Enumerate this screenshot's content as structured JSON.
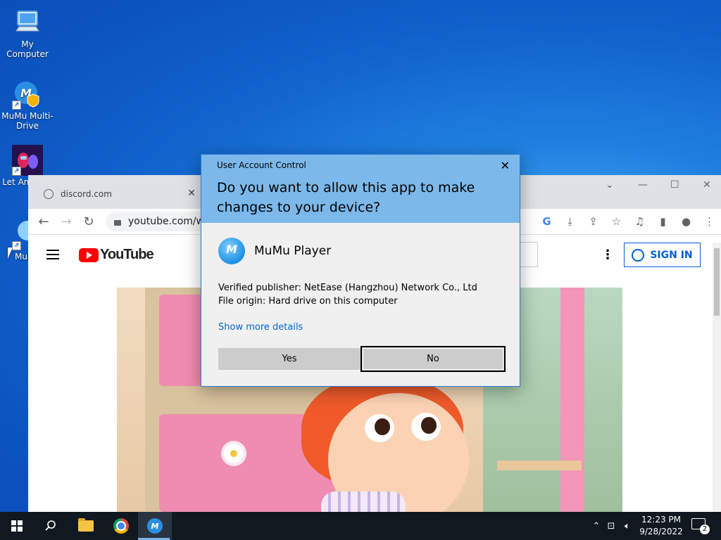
{
  "desktop": {
    "icons": [
      {
        "label": "My Computer"
      },
      {
        "label": "MuMu Multi-Drive"
      },
      {
        "label": "Let Am Us L"
      },
      {
        "label": "MuMu"
      }
    ]
  },
  "browser": {
    "tab_title": "discord.com",
    "tab_close": "✕",
    "address": "youtube.com/wa",
    "window_controls": {
      "dropdown": "⌄",
      "minimize": "—",
      "maximize": "☐",
      "close": "✕"
    }
  },
  "youtube": {
    "logo_text": "YouTube",
    "sign_in": "SIGN IN"
  },
  "uac": {
    "title": "User Account Control",
    "question": "Do you want to allow this app to make changes to your device?",
    "app_name": "MuMu Player",
    "publisher": "Verified publisher: NetEase (Hangzhou) Network Co., Ltd",
    "origin": "File origin: Hard drive on this computer",
    "more_details": "Show more details",
    "yes_label": "Yes",
    "no_label": "No",
    "close": "✕"
  },
  "taskbar": {
    "time": "12:23 PM",
    "date": "9/28/2022",
    "notification_count": "2"
  },
  "colors": {
    "uac_header": "#7cb8ea",
    "link": "#0066cc",
    "youtube_red": "#ff0000",
    "signin_blue": "#065fd4"
  }
}
